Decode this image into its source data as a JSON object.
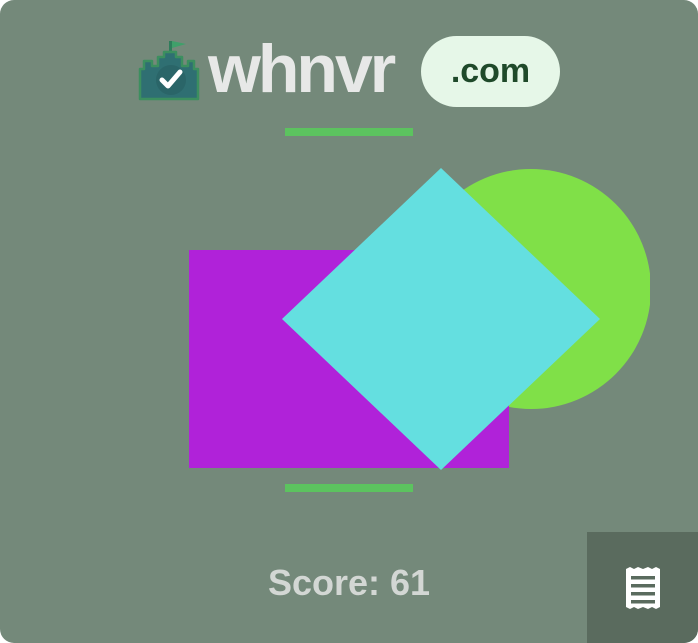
{
  "brand": {
    "name": "whnvr",
    "tld": ".com",
    "logo_icon": "castle-check-icon"
  },
  "colors": {
    "background": "#74897a",
    "accent_line": "#5cc35f",
    "pill_background": "#e6f7e8",
    "pill_text": "#1f4a2a",
    "wordmark": "#e7e8e7",
    "receipt_button": "#5a6b5e"
  },
  "puzzle": {
    "shapes": [
      {
        "shape": "rectangle",
        "color": "#b022d9"
      },
      {
        "shape": "circle",
        "color": "#80e048"
      },
      {
        "shape": "diamond",
        "color": "#64dfe0"
      }
    ]
  },
  "score": {
    "label": "Score:",
    "value": "61"
  },
  "menu": {
    "icon": "receipt-icon"
  }
}
